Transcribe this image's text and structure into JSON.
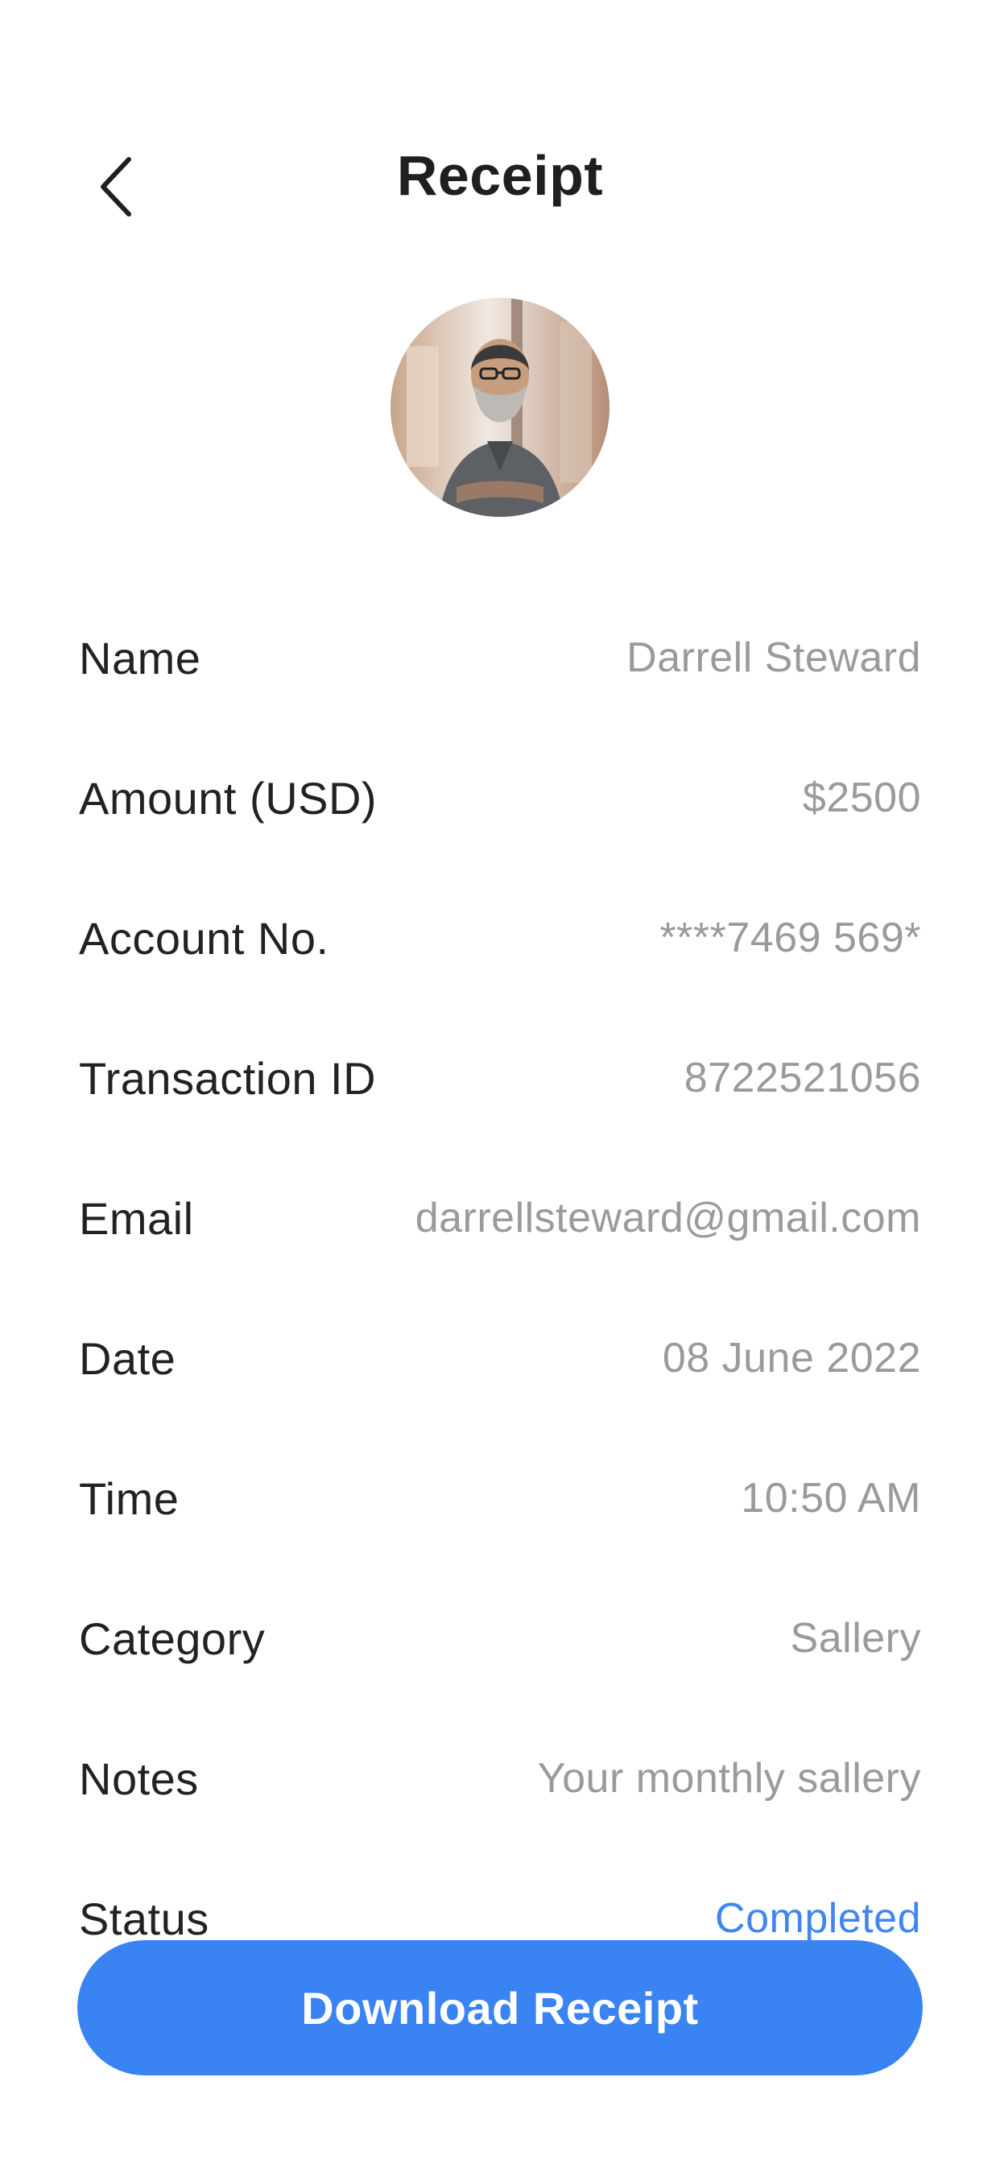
{
  "header": {
    "title": "Receipt",
    "back_icon": "chevron-left-icon"
  },
  "avatar": {
    "description_icon": "user-avatar-photo"
  },
  "receipt": {
    "rows": [
      {
        "label": "Name",
        "value": "Darrell Steward"
      },
      {
        "label": "Amount (USD)",
        "value": "$2500"
      },
      {
        "label": "Account No.",
        "value": "****7469 569*"
      },
      {
        "label": "Transaction ID",
        "value": "8722521056"
      },
      {
        "label": "Email",
        "value": "darrellsteward@gmail.com"
      },
      {
        "label": "Date",
        "value": "08 June 2022"
      },
      {
        "label": "Time",
        "value": "10:50 AM"
      },
      {
        "label": "Category",
        "value": "Sallery"
      },
      {
        "label": "Notes",
        "value": "Your monthly sallery"
      },
      {
        "label": "Status",
        "value": "Completed"
      }
    ]
  },
  "actions": {
    "download_label": "Download Receipt"
  },
  "colors": {
    "accent": "#3983f2",
    "status_completed": "#3f86f0",
    "label_text": "#222222",
    "value_text": "#9a9a9a"
  }
}
